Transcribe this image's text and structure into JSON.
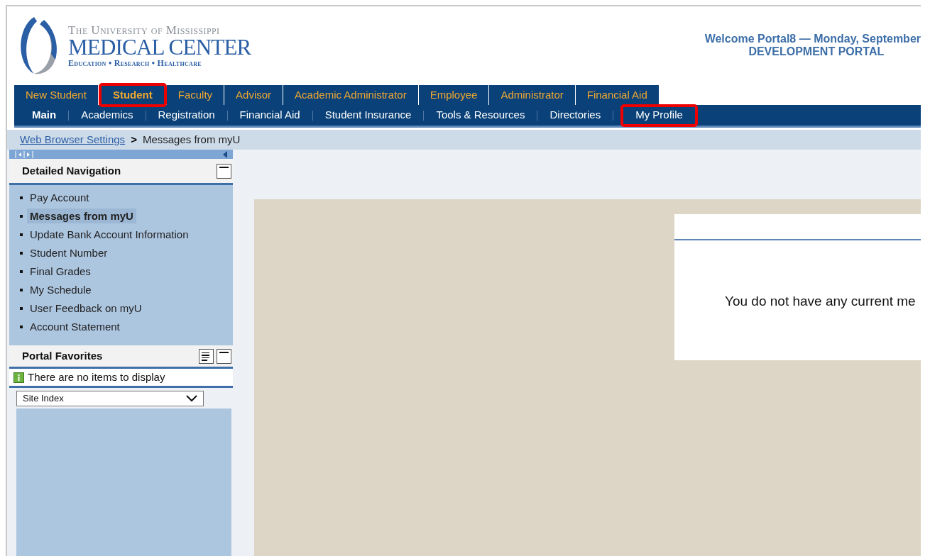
{
  "header": {
    "logo": {
      "line1": "The University of Mississippi",
      "line2": "MEDICAL CENTER",
      "line3": "Education • Research • Healthcare"
    },
    "welcome": "Welcome Portal8 — Monday, September",
    "portal": "DEVELOPMENT PORTAL"
  },
  "role_tabs": [
    {
      "label": "New Student",
      "selected": false,
      "highlighted": false
    },
    {
      "label": "Student",
      "selected": true,
      "highlighted": true
    },
    {
      "label": "Faculty",
      "selected": false,
      "highlighted": false
    },
    {
      "label": "Advisor",
      "selected": false,
      "highlighted": false
    },
    {
      "label": "Academic Administrator",
      "selected": false,
      "highlighted": false
    },
    {
      "label": "Employee",
      "selected": false,
      "highlighted": false
    },
    {
      "label": "Administrator",
      "selected": false,
      "highlighted": false
    },
    {
      "label": "Financial Aid",
      "selected": false,
      "highlighted": false
    }
  ],
  "sub_tabs": [
    {
      "label": "Main",
      "selected": true,
      "highlighted": false
    },
    {
      "label": "Academics",
      "selected": false,
      "highlighted": false
    },
    {
      "label": "Registration",
      "selected": false,
      "highlighted": false
    },
    {
      "label": "Financial Aid",
      "selected": false,
      "highlighted": false
    },
    {
      "label": "Student Insurance",
      "selected": false,
      "highlighted": false
    },
    {
      "label": "Tools & Resources",
      "selected": false,
      "highlighted": false
    },
    {
      "label": "Directories",
      "selected": false,
      "highlighted": false
    },
    {
      "label": "My Profile",
      "selected": false,
      "highlighted": true
    }
  ],
  "breadcrumb": {
    "link": "Web Browser Settings",
    "separator": ">",
    "current": "Messages from myU"
  },
  "detailed_navigation": {
    "title": "Detailed Navigation",
    "items": [
      {
        "label": "Pay Account",
        "selected": false
      },
      {
        "label": "Messages from myU",
        "selected": true
      },
      {
        "label": "Update Bank Account Information",
        "selected": false
      },
      {
        "label": "Student Number",
        "selected": false
      },
      {
        "label": "Final Grades",
        "selected": false
      },
      {
        "label": "My Schedule",
        "selected": false
      },
      {
        "label": "User Feedback on myU",
        "selected": false
      },
      {
        "label": "Account Statement",
        "selected": false
      }
    ]
  },
  "portal_favorites": {
    "title": "Portal Favorites",
    "message": "There are no items to display",
    "dropdown": "Site Index"
  },
  "content": {
    "message": "You do not have any current me"
  }
}
